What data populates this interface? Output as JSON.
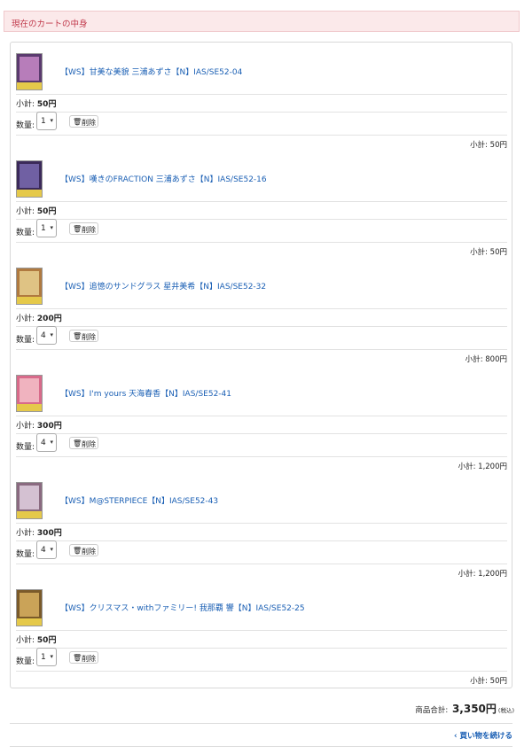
{
  "header": {
    "title": "現在のカートの中身"
  },
  "items": [
    {
      "name": "【WS】甘美な美貌 三浦あずさ【N】IAS/SE52-04",
      "subtotal_label": "小計",
      "unit_price": "50円",
      "qty_label": "数量:",
      "qty": "1",
      "delete_label": "削除",
      "line_total": "50円",
      "thumb_color": "#5a3a6e",
      "thumb_accent": "#c88ac8"
    },
    {
      "name": "【WS】嘆きのFRACTION 三浦あずさ【N】IAS/SE52-16",
      "subtotal_label": "小計",
      "unit_price": "50円",
      "qty_label": "数量:",
      "qty": "1",
      "delete_label": "削除",
      "line_total": "50円",
      "thumb_color": "#3b2a5a",
      "thumb_accent": "#7a6ab0"
    },
    {
      "name": "【WS】追憶のサンドグラス 星井美希【N】IAS/SE52-32",
      "subtotal_label": "小計",
      "unit_price": "200円",
      "qty_label": "数量:",
      "qty": "4",
      "delete_label": "削除",
      "line_total": "800円",
      "thumb_color": "#b07a40",
      "thumb_accent": "#e8d090"
    },
    {
      "name": "【WS】I'm yours 天海春香【N】IAS/SE52-41",
      "subtotal_label": "小計",
      "unit_price": "300円",
      "qty_label": "数量:",
      "qty": "4",
      "delete_label": "削除",
      "line_total": "1,200円",
      "thumb_color": "#d86a8a",
      "thumb_accent": "#f4c0c8"
    },
    {
      "name": "【WS】M@STERPIECE【N】IAS/SE52-43",
      "subtotal_label": "小計",
      "unit_price": "300円",
      "qty_label": "数量:",
      "qty": "4",
      "delete_label": "削除",
      "line_total": "1,200円",
      "thumb_color": "#8a6a80",
      "thumb_accent": "#e0d0e0"
    },
    {
      "name": "【WS】クリスマス・withファミリー! 我那覇 響【N】IAS/SE52-25",
      "subtotal_label": "小計",
      "unit_price": "50円",
      "qty_label": "数量:",
      "qty": "1",
      "delete_label": "削除",
      "line_total": "50円",
      "thumb_color": "#7a5a2a",
      "thumb_accent": "#d8b060"
    }
  ],
  "summary": {
    "label": "商品合計:",
    "amount": "3,350円",
    "tax": "(税込)"
  },
  "continue": {
    "label": "買い物を続ける",
    "icon": "chevron-left-icon"
  },
  "delete_icon": "trash-icon"
}
